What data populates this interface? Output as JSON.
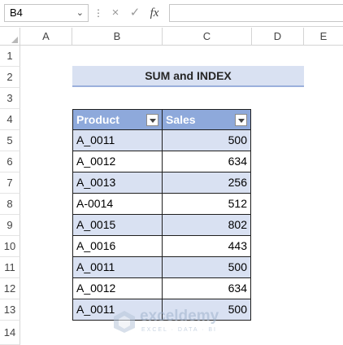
{
  "formula_bar": {
    "name_box": "B4",
    "cancel_icon": "×",
    "enter_icon": "✓",
    "fx_label": "fx",
    "formula": ""
  },
  "columns": [
    "A",
    "B",
    "C",
    "D",
    "E"
  ],
  "rows": [
    "1",
    "2",
    "3",
    "4",
    "5",
    "6",
    "7",
    "8",
    "9",
    "10",
    "11",
    "12",
    "13",
    "14"
  ],
  "title": "SUM and INDEX",
  "table": {
    "headers": [
      "Product",
      "Sales"
    ],
    "rows": [
      {
        "product": "A_0011",
        "sales": "500"
      },
      {
        "product": "A_0012",
        "sales": "634"
      },
      {
        "product": "A_0013",
        "sales": "256"
      },
      {
        "product": "A-0014",
        "sales": "512"
      },
      {
        "product": "A_0015",
        "sales": "802"
      },
      {
        "product": "A_0016",
        "sales": "443"
      },
      {
        "product": "A_0011",
        "sales": "500"
      },
      {
        "product": "A_0012",
        "sales": "634"
      },
      {
        "product": "A_0011",
        "sales": "500"
      }
    ]
  },
  "watermark": {
    "name": "exceldemy",
    "tagline": "EXCEL · DATA · BI"
  },
  "colors": {
    "header_fill": "#8ea9db",
    "band_fill": "#d9e1f2",
    "title_fill": "#d9e1f2"
  }
}
